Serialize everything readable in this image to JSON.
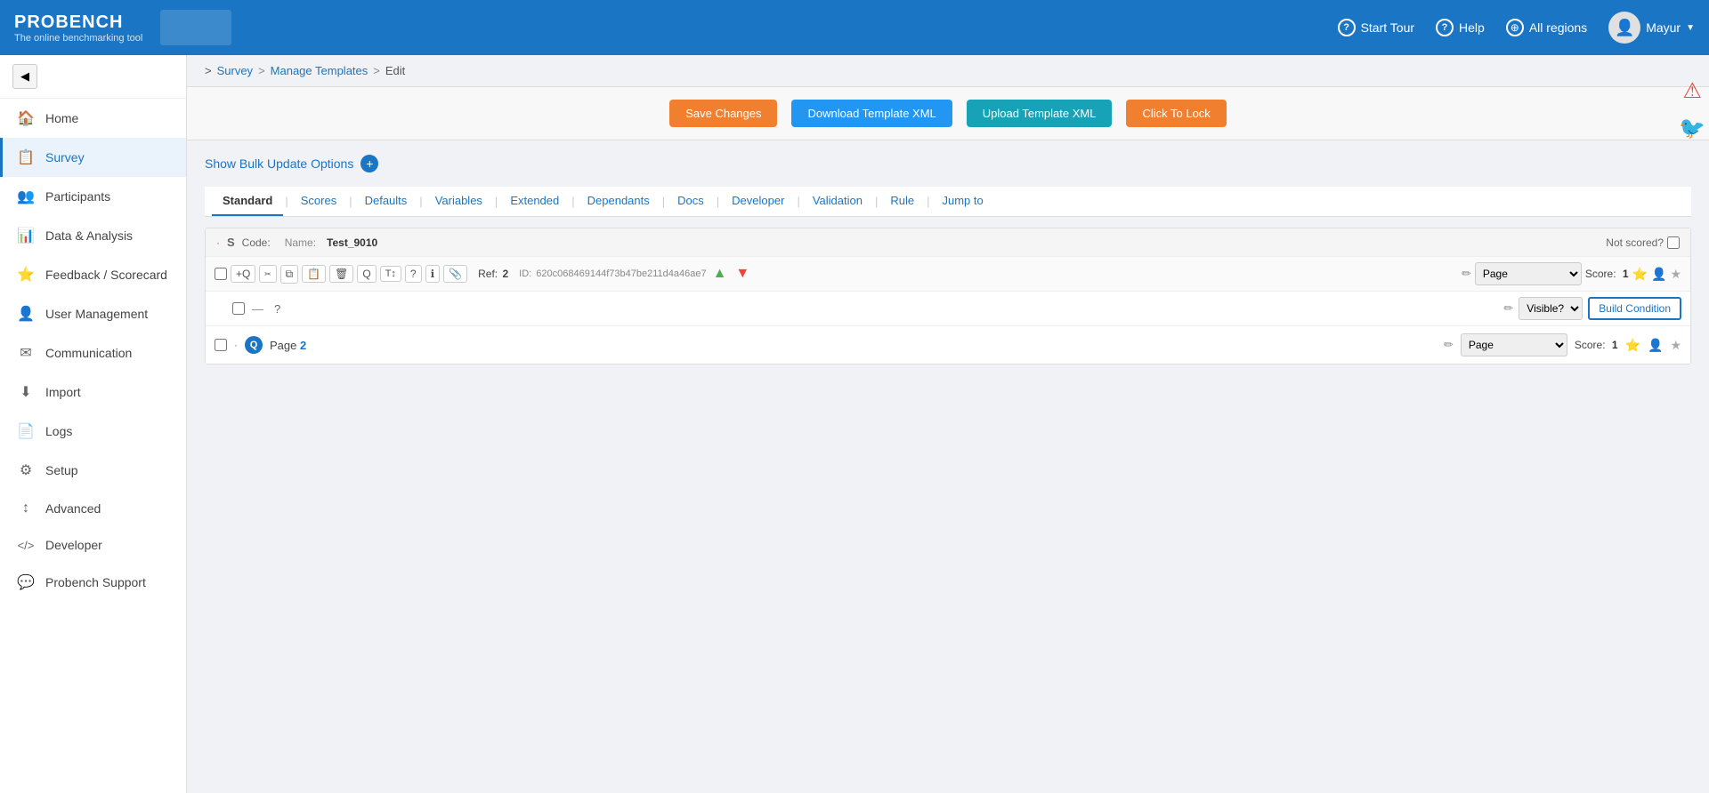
{
  "brand": {
    "name": "PROBENCH",
    "tagline": "The online benchmarking tool"
  },
  "topnav": {
    "start_tour": "Start Tour",
    "help": "Help",
    "all_regions": "All regions",
    "user": "Mayur"
  },
  "sidebar": {
    "items": [
      {
        "id": "home",
        "label": "Home",
        "icon": "🏠"
      },
      {
        "id": "survey",
        "label": "Survey",
        "icon": "📋"
      },
      {
        "id": "participants",
        "label": "Participants",
        "icon": "👥"
      },
      {
        "id": "data-analysis",
        "label": "Data & Analysis",
        "icon": "📊"
      },
      {
        "id": "feedback-scorecard",
        "label": "Feedback / Scorecard",
        "icon": "⭐"
      },
      {
        "id": "user-management",
        "label": "User Management",
        "icon": "👤"
      },
      {
        "id": "communication",
        "label": "Communication",
        "icon": "✉"
      },
      {
        "id": "import",
        "label": "Import",
        "icon": "⬇"
      },
      {
        "id": "logs",
        "label": "Logs",
        "icon": "📄"
      },
      {
        "id": "setup",
        "label": "Setup",
        "icon": "⚙"
      },
      {
        "id": "advanced",
        "label": "Advanced",
        "icon": "↕"
      },
      {
        "id": "developer",
        "label": "Developer",
        "icon": "</>"
      },
      {
        "id": "probench-support",
        "label": "Probench Support",
        "icon": "💬"
      }
    ]
  },
  "breadcrumb": {
    "survey": "Survey",
    "manage_templates": "Manage Templates",
    "edit": "Edit"
  },
  "action_bar": {
    "save_changes": "Save Changes",
    "download_xml": "Download Template XML",
    "upload_xml": "Upload Template XML",
    "click_to_lock": "Click To Lock"
  },
  "bulk_update": {
    "label": "Show Bulk Update Options",
    "icon": "+"
  },
  "tabs": [
    {
      "id": "standard",
      "label": "Standard"
    },
    {
      "id": "scores",
      "label": "Scores"
    },
    {
      "id": "defaults",
      "label": "Defaults"
    },
    {
      "id": "variables",
      "label": "Variables"
    },
    {
      "id": "extended",
      "label": "Extended"
    },
    {
      "id": "dependants",
      "label": "Dependants"
    },
    {
      "id": "docs",
      "label": "Docs"
    },
    {
      "id": "developer",
      "label": "Developer"
    },
    {
      "id": "validation",
      "label": "Validation"
    },
    {
      "id": "rule",
      "label": "Rule"
    },
    {
      "id": "jump_to",
      "label": "Jump to"
    }
  ],
  "survey_section": {
    "s_label": "S",
    "code_label": "Code:",
    "name_label": "Name:",
    "name_value": "Test_9010",
    "not_scored": "Not scored?",
    "ref_label": "Ref:",
    "ref_value": "2",
    "id_label": "ID:",
    "id_value": "620c068469144f73b47be211d4a46ae7",
    "page_options": [
      "Page"
    ],
    "score_label": "Score:",
    "score_value": "1",
    "visible_options": [
      "Visible?"
    ],
    "build_condition": "Build Condition",
    "q_page_label": "Page",
    "q_page_num": "2",
    "q_score_label": "Score:",
    "q_score_value": "1"
  }
}
